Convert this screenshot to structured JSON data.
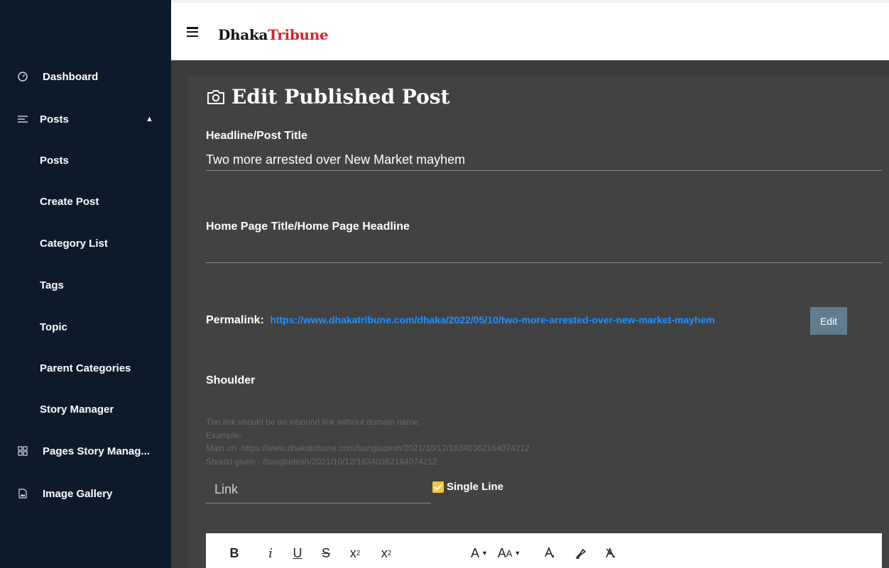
{
  "sidebar": {
    "items": [
      {
        "label": "Dashboard",
        "icon": "gauge-icon"
      },
      {
        "label": "Posts",
        "icon": "lines-icon",
        "expanded": true
      },
      {
        "label": "Posts"
      },
      {
        "label": "Create Post"
      },
      {
        "label": "Category List"
      },
      {
        "label": "Tags"
      },
      {
        "label": "Topic"
      },
      {
        "label": "Parent Categories"
      },
      {
        "label": "Story Manager"
      },
      {
        "label": "Pages Story Manag...",
        "icon": "grid-icon"
      },
      {
        "label": "Image Gallery",
        "icon": "file-image-icon"
      }
    ]
  },
  "header": {
    "logo_part1": "Dhaka",
    "logo_part2": "Tribune",
    "logo_color_dark": "#111111",
    "logo_color_red": "#d6262e"
  },
  "form": {
    "page_title": "Edit Published Post",
    "headline_label": "Headline/Post Title",
    "headline_value": "Two more arrested over New Market mayhem",
    "homepage_label": "Home Page Title/Home Page Headline",
    "homepage_value": "",
    "permalink_label": "Permalink:",
    "permalink_url": "https://www.dhakatribune.com/dhaka/2022/05/10/two-more-arrested-over-new-market-mayhem",
    "edit_button": "Edit",
    "shoulder_label": "Shoulder",
    "hint_lines": [
      "The link should be an inbound link without domain name.",
      "Example-",
      "Main url -https://www.dhakatribune.com/bangladesh/2021/10/12/16340362164074212",
      "Should given - /bangladesh/2021/10/12/16340362164074212"
    ],
    "link_placeholder": "Link",
    "single_line_label": "Single Line",
    "single_line_checked": true
  },
  "toolbar": {
    "buttons": [
      "bold",
      "italic",
      "underline",
      "strikethrough",
      "subscript",
      "superscript",
      "font-color",
      "font-size",
      "text-color",
      "highlight",
      "clear-format"
    ]
  },
  "colors": {
    "sidebar_bg": "#0c1a2c",
    "panel_bg": "#424242",
    "accent_link": "#1e90ff",
    "edit_button_bg": "#5f7d8f",
    "checkbox": "#f5c542"
  }
}
